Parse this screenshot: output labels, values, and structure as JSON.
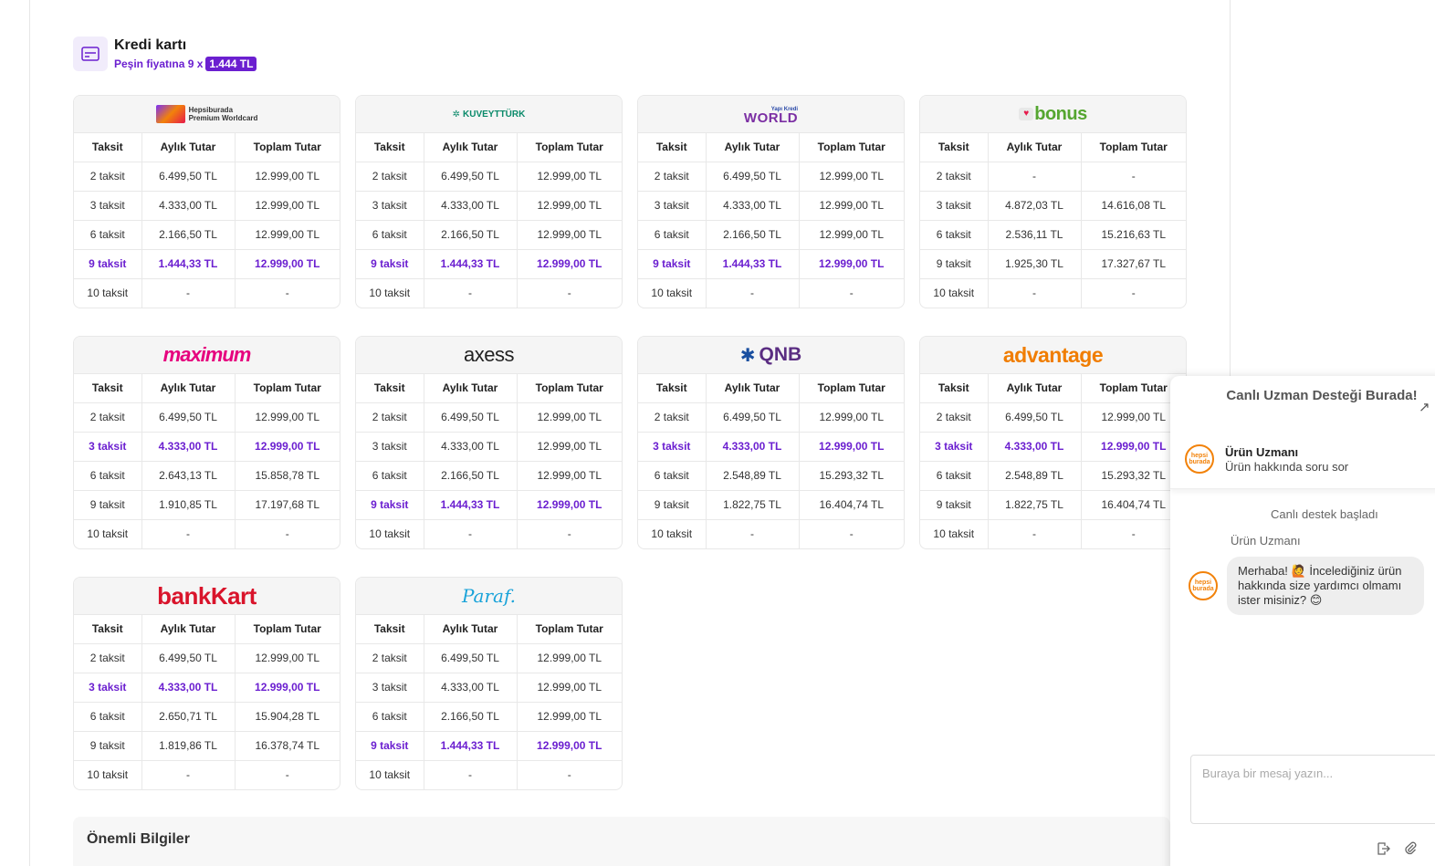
{
  "kredi": {
    "title": "Kredi kartı",
    "subtitle": "Peşin fiyatına 9 x",
    "price": "1.444 TL"
  },
  "banks": [
    {
      "name": "Hepsiburada Premium Worldcard",
      "logo_line1": "Hepsiburada",
      "logo_line2": "Premium Worldcard",
      "headers": [
        "Taksit",
        "Aylık Tutar",
        "Toplam Tutar"
      ],
      "rows": [
        {
          "t": "2 taksit",
          "a": "6.499,50 TL",
          "b": "12.999,00 TL"
        },
        {
          "t": "3 taksit",
          "a": "4.333,00 TL",
          "b": "12.999,00 TL"
        },
        {
          "t": "6 taksit",
          "a": "2.166,50 TL",
          "b": "12.999,00 TL"
        },
        {
          "t": "9 taksit",
          "a": "1.444,33 TL",
          "b": "12.999,00 TL"
        },
        {
          "t": "10 taksit",
          "a": "-",
          "b": "-"
        }
      ],
      "highlight": 3
    },
    {
      "name": "KuveytTürk",
      "logo": "KUVEYTTÜRK",
      "headers": [
        "Taksit",
        "Aylık Tutar",
        "Toplam Tutar"
      ],
      "rows": [
        {
          "t": "2 taksit",
          "a": "6.499,50 TL",
          "b": "12.999,00 TL"
        },
        {
          "t": "3 taksit",
          "a": "4.333,00 TL",
          "b": "12.999,00 TL"
        },
        {
          "t": "6 taksit",
          "a": "2.166,50 TL",
          "b": "12.999,00 TL"
        },
        {
          "t": "9 taksit",
          "a": "1.444,33 TL",
          "b": "12.999,00 TL"
        },
        {
          "t": "10 taksit",
          "a": "-",
          "b": "-"
        }
      ],
      "highlight": 3
    },
    {
      "name": "World",
      "logo": "WORLD",
      "logo_small": "Yapı Kredi",
      "headers": [
        "Taksit",
        "Aylık Tutar",
        "Toplam Tutar"
      ],
      "rows": [
        {
          "t": "2 taksit",
          "a": "6.499,50 TL",
          "b": "12.999,00 TL"
        },
        {
          "t": "3 taksit",
          "a": "4.333,00 TL",
          "b": "12.999,00 TL"
        },
        {
          "t": "6 taksit",
          "a": "2.166,50 TL",
          "b": "12.999,00 TL"
        },
        {
          "t": "9 taksit",
          "a": "1.444,33 TL",
          "b": "12.999,00 TL"
        },
        {
          "t": "10 taksit",
          "a": "-",
          "b": "-"
        }
      ],
      "highlight": 3
    },
    {
      "name": "Bonus",
      "logo": "bonus",
      "headers": [
        "Taksit",
        "Aylık Tutar",
        "Toplam Tutar"
      ],
      "rows": [
        {
          "t": "2 taksit",
          "a": "-",
          "b": "-"
        },
        {
          "t": "3 taksit",
          "a": "4.872,03 TL",
          "b": "14.616,08 TL"
        },
        {
          "t": "6 taksit",
          "a": "2.536,11 TL",
          "b": "15.216,63 TL"
        },
        {
          "t": "9 taksit",
          "a": "1.925,30 TL",
          "b": "17.327,67 TL"
        },
        {
          "t": "10 taksit",
          "a": "-",
          "b": "-"
        }
      ],
      "highlight": -1
    },
    {
      "name": "Maximum",
      "logo": "maximum",
      "headers": [
        "Taksit",
        "Aylık Tutar",
        "Toplam Tutar"
      ],
      "rows": [
        {
          "t": "2 taksit",
          "a": "6.499,50 TL",
          "b": "12.999,00 TL"
        },
        {
          "t": "3 taksit",
          "a": "4.333,00 TL",
          "b": "12.999,00 TL"
        },
        {
          "t": "6 taksit",
          "a": "2.643,13 TL",
          "b": "15.858,78 TL"
        },
        {
          "t": "9 taksit",
          "a": "1.910,85 TL",
          "b": "17.197,68 TL"
        },
        {
          "t": "10 taksit",
          "a": "-",
          "b": "-"
        }
      ],
      "highlight": 1
    },
    {
      "name": "Axess",
      "logo": "axess",
      "headers": [
        "Taksit",
        "Aylık Tutar",
        "Toplam Tutar"
      ],
      "rows": [
        {
          "t": "2 taksit",
          "a": "6.499,50 TL",
          "b": "12.999,00 TL"
        },
        {
          "t": "3 taksit",
          "a": "4.333,00 TL",
          "b": "12.999,00 TL"
        },
        {
          "t": "6 taksit",
          "a": "2.166,50 TL",
          "b": "12.999,00 TL"
        },
        {
          "t": "9 taksit",
          "a": "1.444,33 TL",
          "b": "12.999,00 TL"
        },
        {
          "t": "10 taksit",
          "a": "-",
          "b": "-"
        }
      ],
      "highlight": 3
    },
    {
      "name": "QNB",
      "logo": "QNB",
      "headers": [
        "Taksit",
        "Aylık Tutar",
        "Toplam Tutar"
      ],
      "rows": [
        {
          "t": "2 taksit",
          "a": "6.499,50 TL",
          "b": "12.999,00 TL"
        },
        {
          "t": "3 taksit",
          "a": "4.333,00 TL",
          "b": "12.999,00 TL"
        },
        {
          "t": "6 taksit",
          "a": "2.548,89 TL",
          "b": "15.293,32 TL"
        },
        {
          "t": "9 taksit",
          "a": "1.822,75 TL",
          "b": "16.404,74 TL"
        },
        {
          "t": "10 taksit",
          "a": "-",
          "b": "-"
        }
      ],
      "highlight": 1
    },
    {
      "name": "Advantage",
      "logo": "advantage",
      "headers": [
        "Taksit",
        "Aylık Tutar",
        "Toplam Tutar"
      ],
      "rows": [
        {
          "t": "2 taksit",
          "a": "6.499,50 TL",
          "b": "12.999,00 TL"
        },
        {
          "t": "3 taksit",
          "a": "4.333,00 TL",
          "b": "12.999,00 TL"
        },
        {
          "t": "6 taksit",
          "a": "2.548,89 TL",
          "b": "15.293,32 TL"
        },
        {
          "t": "9 taksit",
          "a": "1.822,75 TL",
          "b": "16.404,74 TL"
        },
        {
          "t": "10 taksit",
          "a": "-",
          "b": "-"
        }
      ],
      "highlight": 1
    },
    {
      "name": "Bankkart",
      "logo": "bankKart",
      "headers": [
        "Taksit",
        "Aylık Tutar",
        "Toplam Tutar"
      ],
      "rows": [
        {
          "t": "2 taksit",
          "a": "6.499,50 TL",
          "b": "12.999,00 TL"
        },
        {
          "t": "3 taksit",
          "a": "4.333,00 TL",
          "b": "12.999,00 TL"
        },
        {
          "t": "6 taksit",
          "a": "2.650,71 TL",
          "b": "15.904,28 TL"
        },
        {
          "t": "9 taksit",
          "a": "1.819,86 TL",
          "b": "16.378,74 TL"
        },
        {
          "t": "10 taksit",
          "a": "-",
          "b": "-"
        }
      ],
      "highlight": 1
    },
    {
      "name": "Paraf",
      "logo": "Paraf.",
      "headers": [
        "Taksit",
        "Aylık Tutar",
        "Toplam Tutar"
      ],
      "rows": [
        {
          "t": "2 taksit",
          "a": "6.499,50 TL",
          "b": "12.999,00 TL"
        },
        {
          "t": "3 taksit",
          "a": "4.333,00 TL",
          "b": "12.999,00 TL"
        },
        {
          "t": "6 taksit",
          "a": "2.166,50 TL",
          "b": "12.999,00 TL"
        },
        {
          "t": "9 taksit",
          "a": "1.444,33 TL",
          "b": "12.999,00 TL"
        },
        {
          "t": "10 taksit",
          "a": "-",
          "b": "-"
        }
      ],
      "highlight": 3
    }
  ],
  "onemli": {
    "title": "Önemli Bilgiler"
  },
  "chat": {
    "title": "Canlı Uzman Desteği Burada!",
    "agent_name": "Ürün Uzmanı",
    "agent_sub": "Ürün hakkında soru sor",
    "avatar_line1": "hepsi",
    "avatar_line2": "burada",
    "started": "Canlı destek başladı",
    "message_author": "Ürün Uzmanı",
    "message": "Merhaba! 🙋 İncelediğiniz ürün hakkında size yardımcı olmamı ister misiniz? 😊",
    "input_placeholder": "Buraya bir mesaj yazın..."
  },
  "colors": {
    "accent": "#6b1fd0",
    "hepsiburada_orange": "#f2820a"
  },
  "icons": [
    "credit-card-icon",
    "expand-icon",
    "exit-icon",
    "paperclip-icon"
  ]
}
